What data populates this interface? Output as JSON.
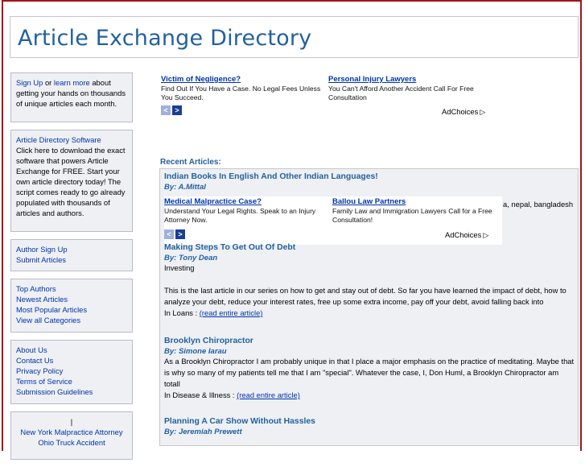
{
  "site": {
    "title": "Article Exchange Directory"
  },
  "sidebar": {
    "signup_box": {
      "signup": "Sign Up",
      "or": "or",
      "learn": "learn more",
      "rest": "about getting your hands on thousands of unique articles each month."
    },
    "software_box": {
      "title": "Article Directory Software",
      "text": "Click here to download the exact software that powers Article Exchange for FREE. Start your own article directory today! The script comes ready to go already populated with thousands of articles and authors."
    },
    "author_links": [
      "Author Sign Up",
      "Submit Articles"
    ],
    "browse_links": [
      "Top Authors",
      "Newest Articles",
      "Most Popular Articles",
      "View all Categories"
    ],
    "info_links": [
      "About Us",
      "Contact Us",
      "Privacy Policy",
      "Terms of Service",
      "Submission Guidelines"
    ],
    "bottom_box": {
      "pipe": "|",
      "link1": "New York Malpractice Attorney",
      "link2": "Ohio Truck Accident"
    }
  },
  "top_ad": {
    "ad1": {
      "title": "Victim of Negligence?",
      "text": "Find Out If You Have a Case. No Legal Fees Unless You Succeed."
    },
    "ad2": {
      "title": "Personal Injury Lawyers",
      "text": "You Can't Afford Another Accident Call For Free Consultation"
    },
    "adchoices": "AdChoices",
    "prev_icon": "<",
    "next_icon": ">"
  },
  "recent": {
    "label": "Recent Articles:",
    "articles": [
      {
        "title": "Indian Books In English And Other Indian Languages!",
        "author": "By: A.Mittal",
        "tail": "a, nepal, bangladesh"
      },
      {
        "title": "Making Steps To Get Out Of Debt",
        "author": "By: Tony Dean",
        "category_line": "Investing",
        "text": "This is the last article in our series on how to get and stay out of debt. So far you have learned the impact of debt, how to analyze your debt, reduce your interest rates, free up some extra income, pay off your debt, avoid falling back into",
        "in": "In Loans :",
        "read": "(read entire article)"
      },
      {
        "title": "Brooklyn Chiropractor",
        "author": "By: Simone Iarau",
        "text": "As a Brooklyn Chiropractor I am probably unique in that I place a major emphasis on the practice of meditating. Maybe that is why so many of my patients tell me that I am \"special\". Whatever the case, I, Don Huml, a Brooklyn Chiropractor am totall",
        "in": "In Disease & Illness :",
        "read": "(read entire article)"
      },
      {
        "title": "Planning A Car Show Without Hassles",
        "author": "By: Jeremiah Prewett"
      }
    ]
  },
  "inline_ad": {
    "ad1": {
      "title": "Medical Malpractice Case?",
      "text": "Understand Your Legal Rights. Speak to an Injury Attorney Now."
    },
    "ad2": {
      "title": "Ballou Law Partners",
      "text": "Family Law and Immigration Lawyers Call for a Free Consultation!"
    },
    "adchoices": "AdChoices",
    "prev_icon": "<",
    "next_icon": ">"
  }
}
